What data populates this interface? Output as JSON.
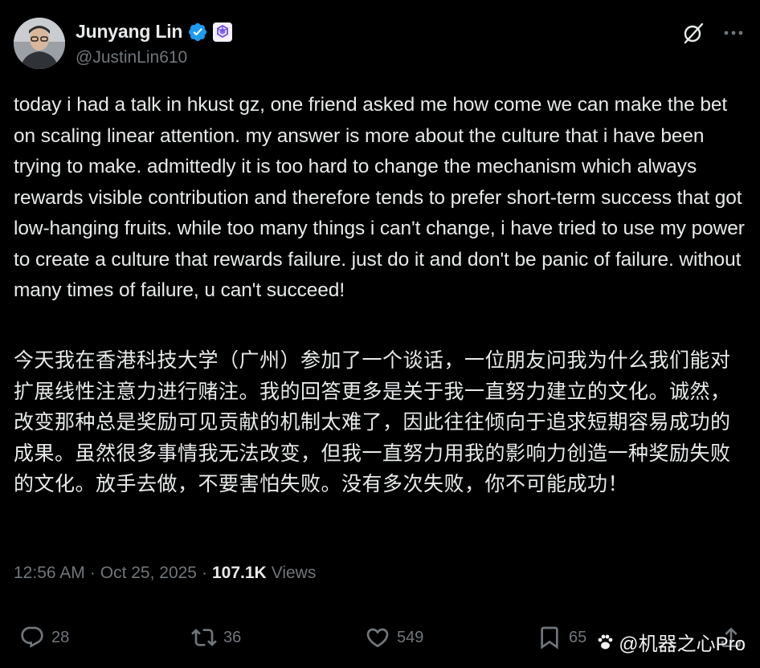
{
  "author": {
    "name": "Junyang Lin",
    "handle": "@JustinLin610"
  },
  "tweet": {
    "text_en": "today i had a talk in hkust gz, one friend asked me how come we can make the bet on scaling linear attention. my answer is more about the culture that i have been trying to make. admittedly it is too hard to change the mechanism which always rewards visible contribution and therefore tends to prefer short-term success that got low-hanging fruits. while too many things i can't change, i have tried to use my power to create a culture that rewards failure. just do it and don't be panic of failure. without many times of failure, u can't succeed!",
    "text_zh": "今天我在香港科技大学（广州）参加了一个谈话，一位朋友问我为什么我们能对扩展线性注意力进行赌注。我的回答更多是关于我一直努力建立的文化。诚然，改变那种总是奖励可见贡献的机制太难了，因此往往倾向于追求短期容易成功的成果。虽然很多事情我无法改变，但我一直努力用我的影响力创造一种奖励失败的文化。放手去做，不要害怕失败。没有多次失败，你不可能成功！"
  },
  "meta": {
    "time": "12:56 AM",
    "sep1": "·",
    "date": "Oct 25, 2025",
    "sep2": "·",
    "views_count": "107.1K",
    "views_label": "Views"
  },
  "actions": {
    "replies": "28",
    "reposts": "36",
    "likes": "549",
    "bookmarks": "65"
  },
  "watermark": "@机器之心Pro",
  "colors": {
    "background": "#000000",
    "text": "#e7e9ea",
    "secondary": "#71767b",
    "verified": "#1d9bf0"
  }
}
